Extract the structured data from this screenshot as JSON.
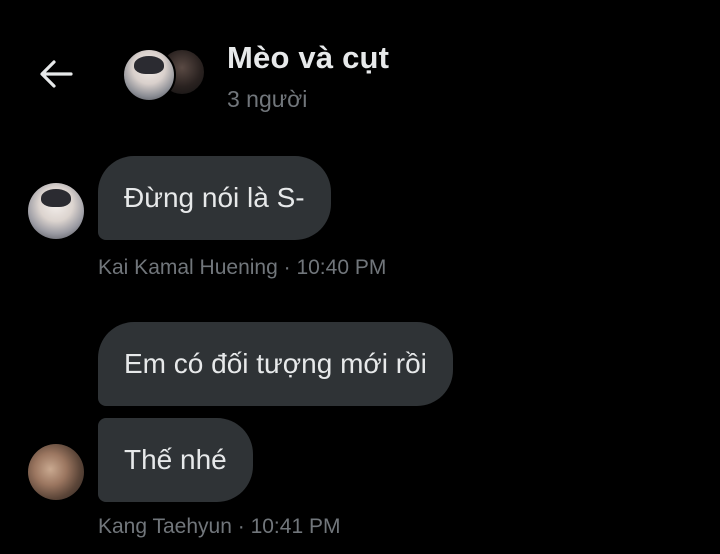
{
  "header": {
    "title": "Mèo và cụt",
    "subtitle": "3 người",
    "back_icon": "back-arrow-icon"
  },
  "messages": [
    {
      "text": "Đừng nói là S-"
    },
    {
      "text": "Em có đối tượng mới rồi"
    },
    {
      "text": "Thế nhé"
    }
  ],
  "meta": [
    {
      "sender": "Kai Kamal Huening",
      "sep": " · ",
      "time": "10:40 PM"
    },
    {
      "sender": "Kang Taehyun",
      "sep": " · ",
      "time": "10:41 PM"
    }
  ],
  "colors": {
    "background": "#000000",
    "bubble": "#2f3336",
    "text": "#e7e9ea",
    "secondary_text": "#71767b"
  }
}
